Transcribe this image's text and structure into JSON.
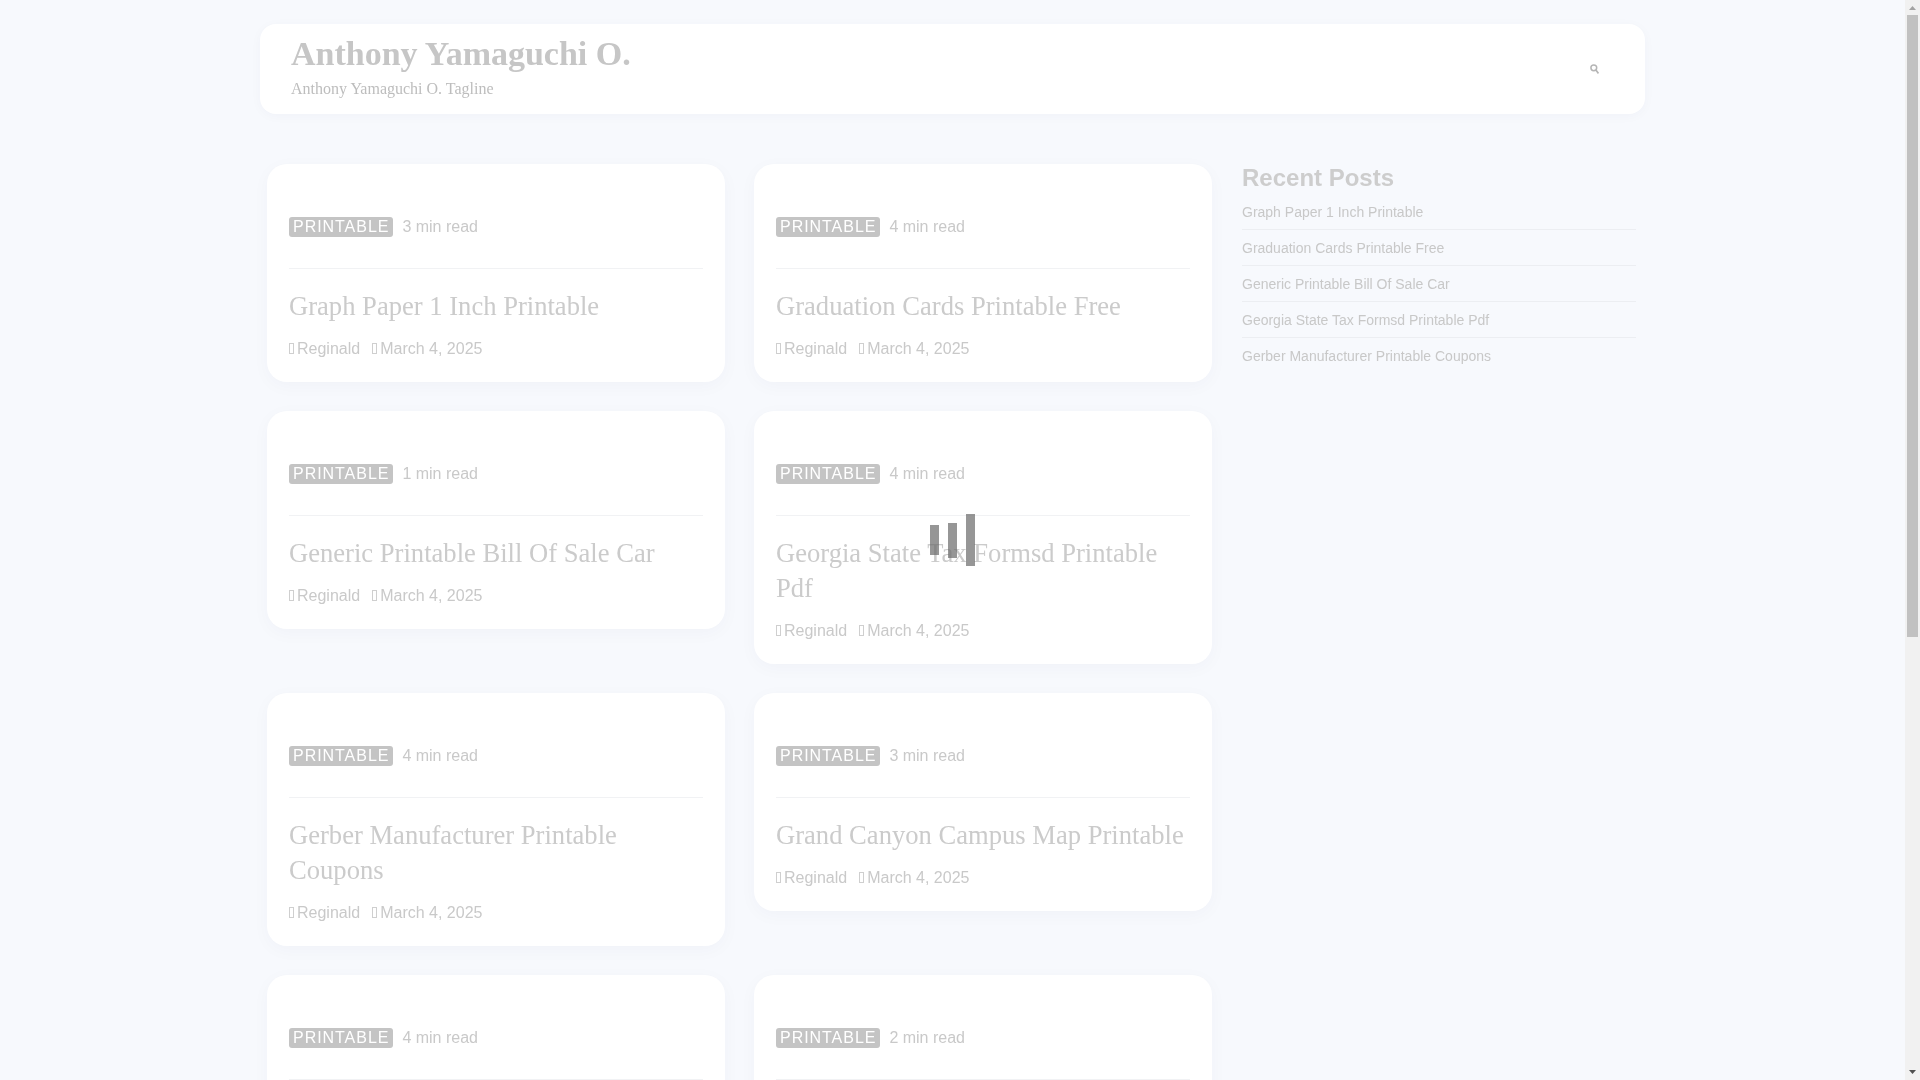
{
  "header": {
    "site_title": "Anthony Yamaguchi O.",
    "tagline": "Anthony Yamaguchi O. Tagline"
  },
  "posts": [
    {
      "category": "PRINTABLE",
      "read_time": "3 min read",
      "title": "Graph Paper 1 Inch Printable",
      "author": "Reginald",
      "date": "March 4, 2025"
    },
    {
      "category": "PRINTABLE",
      "read_time": "4 min read",
      "title": "Graduation Cards Printable Free",
      "author": "Reginald",
      "date": "March 4, 2025"
    },
    {
      "category": "PRINTABLE",
      "read_time": "1 min read",
      "title": "Generic Printable Bill Of Sale Car",
      "author": "Reginald",
      "date": "March 4, 2025"
    },
    {
      "category": "PRINTABLE",
      "read_time": "4 min read",
      "title": "Georgia State Tax Formsd Printable Pdf",
      "author": "Reginald",
      "date": "March 4, 2025"
    },
    {
      "category": "PRINTABLE",
      "read_time": "4 min read",
      "title": "Gerber Manufacturer Printable Coupons",
      "author": "Reginald",
      "date": "March 4, 2025"
    },
    {
      "category": "PRINTABLE",
      "read_time": "3 min read",
      "title": "Grand Canyon Campus Map Printable",
      "author": "Reginald",
      "date": "March 4, 2025"
    },
    {
      "category": "PRINTABLE",
      "read_time": "4 min read"
    },
    {
      "category": "PRINTABLE",
      "read_time": "2 min read"
    }
  ],
  "sidebar": {
    "heading": "Recent Posts",
    "items": [
      "Graph Paper 1 Inch Printable",
      "Graduation Cards Printable Free",
      "Generic Printable Bill Of Sale Car",
      "Georgia State Tax Formsd Printable Pdf",
      "Gerber Manufacturer Printable Coupons"
    ]
  }
}
